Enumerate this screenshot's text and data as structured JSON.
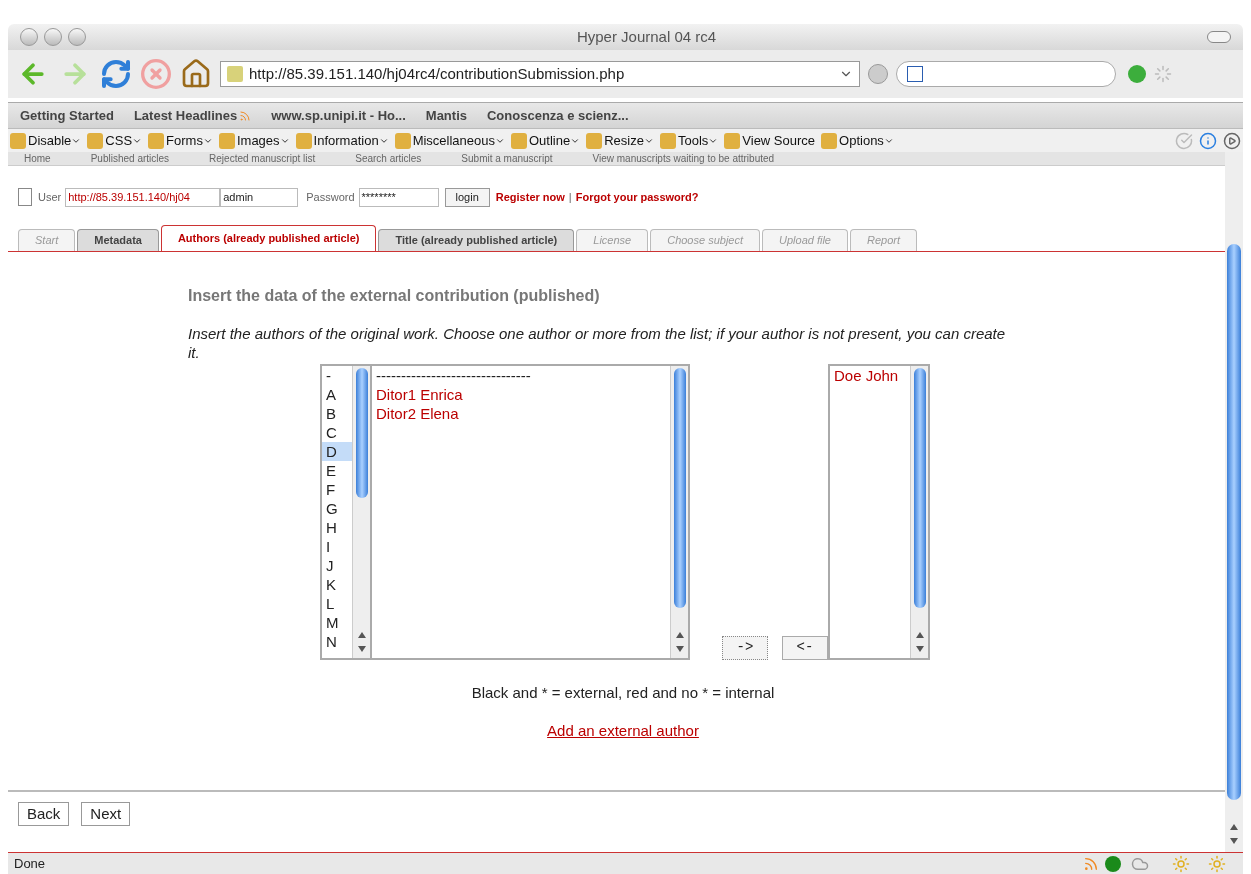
{
  "window": {
    "title": "Hyper Journal 04 rc4"
  },
  "toolbar": {
    "url": "http://85.39.151.140/hj04rc4/contributionSubmission.php"
  },
  "bookmarks": [
    "Getting Started",
    "Latest Headlines",
    "www.sp.unipi.it - Ho...",
    "Mantis",
    "Conoscenza e scienz..."
  ],
  "dev_toolbar": [
    "Disable",
    "CSS",
    "Forms",
    "Images",
    "Information",
    "Miscellaneous",
    "Outline",
    "Resize",
    "Tools",
    "View Source",
    "Options"
  ],
  "site_nav": [
    "Home",
    "Published articles",
    "Rejected manuscript list",
    "Search articles",
    "Submit a manuscript",
    "View manuscripts waiting to be attributed"
  ],
  "login": {
    "user_label": "User",
    "url_value": "http://85.39.151.140/hj04",
    "user_value": "admin",
    "password_label": "Password",
    "password_value": "********",
    "login_button": "login",
    "register": "Register now",
    "separator": "|",
    "forgot": "Forgot your password?"
  },
  "tabs": [
    {
      "label": "Start",
      "selected": false,
      "disabled": true
    },
    {
      "label": "Metadata",
      "selected": false,
      "disabled": false
    },
    {
      "label": "Authors (already published article)",
      "selected": true,
      "disabled": false
    },
    {
      "label": "Title (already published article)",
      "selected": false,
      "disabled": false
    },
    {
      "label": "License",
      "selected": false,
      "disabled": true
    },
    {
      "label": "Choose subject",
      "selected": false,
      "disabled": true
    },
    {
      "label": "Upload file",
      "selected": false,
      "disabled": true
    },
    {
      "label": "Report",
      "selected": false,
      "disabled": true
    }
  ],
  "heading": "Insert the data of the external contribution (published)",
  "instructions": "Insert the authors of the original work. Choose one author or more from the list; if your author is not present, you can create it.",
  "letters": [
    {
      "label": "-",
      "selected": false
    },
    {
      "label": "A",
      "selected": false
    },
    {
      "label": "B",
      "selected": false
    },
    {
      "label": "C",
      "selected": false
    },
    {
      "label": "D",
      "selected": true
    },
    {
      "label": "E",
      "selected": false
    },
    {
      "label": "F",
      "selected": false
    },
    {
      "label": "G",
      "selected": false
    },
    {
      "label": "H",
      "selected": false
    },
    {
      "label": "I",
      "selected": false
    },
    {
      "label": "J",
      "selected": false
    },
    {
      "label": "K",
      "selected": false
    },
    {
      "label": "L",
      "selected": false
    },
    {
      "label": "M",
      "selected": false
    },
    {
      "label": "N",
      "selected": false
    }
  ],
  "authors": [
    {
      "name": "-------------------------------",
      "internal": false
    },
    {
      "name": "Ditor1 Enrica",
      "internal": true
    },
    {
      "name": "Ditor2 Elena",
      "internal": true
    }
  ],
  "add_button": "->",
  "remove_button": "<-",
  "chosen": [
    {
      "name": "Doe John",
      "internal": true
    }
  ],
  "legend": "Black and * = external, red and no * = internal",
  "add_link": "Add an external author",
  "buttons": [
    "Back",
    "Next"
  ],
  "status_bar": {
    "text": "Done"
  }
}
